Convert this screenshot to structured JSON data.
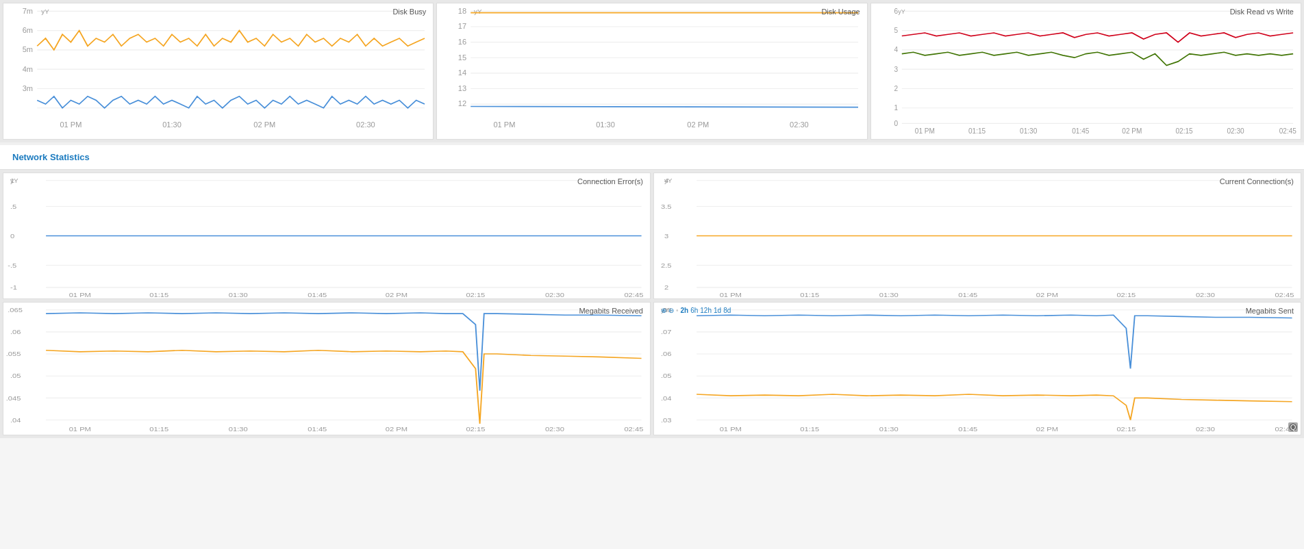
{
  "dashboard": {
    "background": "#f0f0f0"
  },
  "section": {
    "network_statistics_label": "Network Statistics"
  },
  "top_charts": [
    {
      "id": "disk-busy",
      "title": "Disk Busy",
      "y_labels": [
        "7m",
        "6m",
        "5m",
        "4m",
        "3m"
      ],
      "x_labels": [
        "01 PM",
        "01:30",
        "02 PM",
        "02:30"
      ],
      "series": [
        {
          "color": "#f5a623",
          "label": "orange"
        },
        {
          "color": "#4a90d9",
          "label": "blue"
        }
      ]
    },
    {
      "id": "disk-usage",
      "title": "Disk Usage",
      "y_labels": [
        "18",
        "17",
        "16",
        "15",
        "14",
        "13",
        "12"
      ],
      "x_labels": [
        "01 PM",
        "01:30",
        "02 PM",
        "02:30"
      ],
      "series": [
        {
          "color": "#f5a623",
          "label": "orange"
        },
        {
          "color": "#4a90d9",
          "label": "blue"
        }
      ]
    },
    {
      "id": "disk-read-write",
      "title": "Disk Read vs Write",
      "y_labels": [
        "6",
        "5",
        "4",
        "3",
        "2",
        "1",
        "0"
      ],
      "x_labels": [
        "01 PM",
        "01:15",
        "01:30",
        "01:45",
        "02 PM",
        "02:15",
        "02:30",
        "02:45"
      ],
      "series": [
        {
          "color": "#d0021b",
          "label": "red"
        },
        {
          "color": "#417505",
          "label": "green"
        }
      ]
    }
  ],
  "bottom_charts": [
    {
      "id": "connection-errors",
      "title": "Connection Error(s)",
      "y_labels": [
        "1",
        ".5",
        "0",
        "-.5",
        "-1"
      ],
      "x_labels": [
        "01 PM",
        "01:15",
        "01:30",
        "01:45",
        "02 PM",
        "02:15",
        "02:30",
        "02:45"
      ],
      "series": [
        {
          "color": "#4a90d9"
        }
      ]
    },
    {
      "id": "current-connections",
      "title": "Current Connection(s)",
      "y_labels": [
        "4",
        "3.5",
        "3",
        "2.5",
        "2"
      ],
      "x_labels": [
        "01 PM",
        "01:15",
        "01:30",
        "01:45",
        "02 PM",
        "02:15",
        "02:30",
        "02:45"
      ],
      "series": [
        {
          "color": "#f5a623"
        }
      ]
    },
    {
      "id": "megabits-received",
      "title": "Megabits Received",
      "y_labels": [
        ".065",
        ".06",
        ".055",
        ".05",
        ".045",
        ".04"
      ],
      "x_labels": [
        "01 PM",
        "01:15",
        "01:30",
        "01:45",
        "02 PM",
        "02:15",
        "02:30",
        "02:45"
      ],
      "series": [
        {
          "color": "#4a90d9"
        },
        {
          "color": "#f5a623"
        }
      ]
    },
    {
      "id": "megabits-sent",
      "title": "Megabits Sent",
      "y_labels": [
        ".08",
        ".07",
        ".06",
        ".05",
        ".04",
        ".03"
      ],
      "x_labels": [
        "01 PM",
        "01:15",
        "01:30",
        "01:45",
        "02 PM",
        "02:15",
        "02:30",
        "02:45"
      ],
      "series": [
        {
          "color": "#4a90d9"
        },
        {
          "color": "#f5a623"
        }
      ]
    }
  ],
  "toolbar": {
    "zoom_in": "⊕",
    "zoom_out": "⊖",
    "dot": "•",
    "time_options": [
      "2h",
      "6h",
      "12h",
      "1d",
      "8d"
    ],
    "active_time": "2h"
  }
}
